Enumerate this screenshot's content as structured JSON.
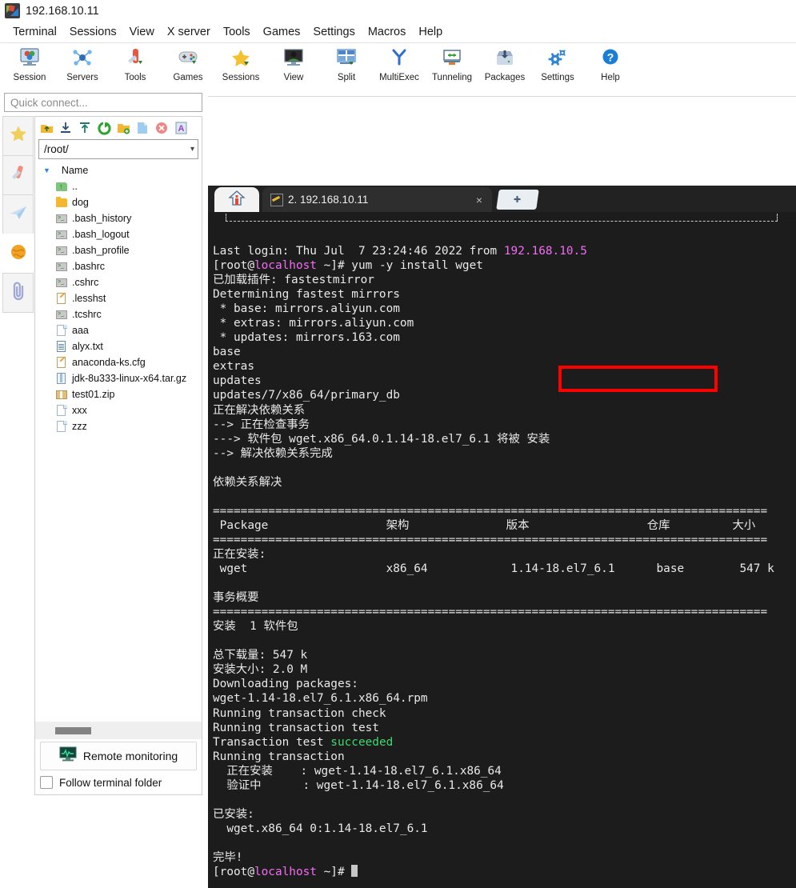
{
  "window": {
    "title": "192.168.10.11",
    "icon": "mobaxterm-logo-icon"
  },
  "menubar": {
    "items": [
      {
        "label": "Terminal"
      },
      {
        "label": "Sessions"
      },
      {
        "label": "View"
      },
      {
        "label": "X server"
      },
      {
        "label": "Tools"
      },
      {
        "label": "Games"
      },
      {
        "label": "Settings"
      },
      {
        "label": "Macros"
      },
      {
        "label": "Help"
      }
    ]
  },
  "toolbar": {
    "buttons": [
      {
        "label": "Session",
        "icon": "session-icon"
      },
      {
        "label": "Servers",
        "icon": "servers-icon"
      },
      {
        "label": "Tools",
        "icon": "tools-icon"
      },
      {
        "label": "Games",
        "icon": "gamepad-icon"
      },
      {
        "label": "Sessions",
        "icon": "star-icon"
      },
      {
        "label": "View",
        "icon": "monitor-icon"
      },
      {
        "label": "Split",
        "icon": "split-icon"
      },
      {
        "label": "MultiExec",
        "icon": "multiexec-icon"
      },
      {
        "label": "Tunneling",
        "icon": "tunneling-icon"
      },
      {
        "label": "Packages",
        "icon": "packages-icon"
      },
      {
        "label": "Settings",
        "icon": "gear-icon"
      },
      {
        "label": "Help",
        "icon": "help-icon"
      }
    ]
  },
  "quick_connect": {
    "placeholder": "Quick connect..."
  },
  "side_tabs": [
    {
      "name": "sessions-star",
      "icon": "star-icon"
    },
    {
      "name": "tools-knife",
      "icon": "swiss-knife-icon"
    },
    {
      "name": "macros-plane",
      "icon": "paper-plane-icon"
    },
    {
      "name": "globe",
      "icon": "globe-icon"
    },
    {
      "name": "attachments",
      "icon": "paperclip-icon"
    }
  ],
  "file_browser": {
    "tool_icons": [
      {
        "name": "go-up-icon"
      },
      {
        "name": "download-icon"
      },
      {
        "name": "upload-icon"
      },
      {
        "name": "refresh-icon"
      },
      {
        "name": "new-folder-icon"
      },
      {
        "name": "new-file-icon"
      },
      {
        "name": "delete-icon"
      },
      {
        "name": "text-mode-icon"
      }
    ],
    "path": "/root/",
    "column_header": "Name",
    "files": [
      {
        "name": "..",
        "type": "up"
      },
      {
        "name": "dog",
        "type": "folder"
      },
      {
        "name": ".bash_history",
        "type": "sh"
      },
      {
        "name": ".bash_logout",
        "type": "sh"
      },
      {
        "name": ".bash_profile",
        "type": "sh"
      },
      {
        "name": ".bashrc",
        "type": "sh"
      },
      {
        "name": ".cshrc",
        "type": "sh"
      },
      {
        "name": ".lesshst",
        "type": "cfg"
      },
      {
        "name": ".tcshrc",
        "type": "sh"
      },
      {
        "name": "aaa",
        "type": "doc"
      },
      {
        "name": "alyx.txt",
        "type": "txt"
      },
      {
        "name": "anaconda-ks.cfg",
        "type": "cfg"
      },
      {
        "name": "jdk-8u333-linux-x64.tar.gz",
        "type": "arch"
      },
      {
        "name": "test01.zip",
        "type": "zipf"
      },
      {
        "name": "xxx",
        "type": "doc"
      },
      {
        "name": "zzz",
        "type": "doc"
      }
    ],
    "remote_monitoring_label": "Remote monitoring",
    "follow_terminal_folder_label": "Follow terminal folder",
    "follow_terminal_folder_checked": false
  },
  "tabs": {
    "home_icon": "home-icon",
    "active_tab_label": "2. 192.168.10.11",
    "close_glyph": "×",
    "new_tab_glyph": "✚"
  },
  "terminal": {
    "highlight_color": "#ff0000",
    "highlighted_command": "yum -y install wget",
    "lines": [
      [
        {
          "t": "Last login: Thu Jul  7 23:24:46 2022 from ",
          "c": "white"
        },
        {
          "t": "192.168.10.5",
          "c": "magenta"
        }
      ],
      [
        {
          "t": "[root@",
          "c": "white"
        },
        {
          "t": "localhost",
          "c": "magenta"
        },
        {
          "t": " ~]# ",
          "c": "white"
        },
        {
          "t": "yum -y install wget",
          "c": "white"
        }
      ],
      [
        {
          "t": "已加载插件: fastestmirror",
          "c": "white"
        }
      ],
      [
        {
          "t": "Determining fastest mirrors",
          "c": "white"
        }
      ],
      [
        {
          "t": " * base: mirrors.aliyun.com",
          "c": "white"
        }
      ],
      [
        {
          "t": " * extras: mirrors.aliyun.com",
          "c": "white"
        }
      ],
      [
        {
          "t": " * updates: mirrors.163.com",
          "c": "white"
        }
      ],
      [
        {
          "t": "base",
          "c": "white"
        }
      ],
      [
        {
          "t": "extras",
          "c": "white"
        }
      ],
      [
        {
          "t": "updates",
          "c": "white"
        }
      ],
      [
        {
          "t": "updates/7/x86_64/primary_db",
          "c": "white"
        }
      ],
      [
        {
          "t": "正在解决依赖关系",
          "c": "white"
        }
      ],
      [
        {
          "t": "--> 正在检查事务",
          "c": "white"
        }
      ],
      [
        {
          "t": "---> 软件包 wget.x86_64.0.1.14-18.el7_6.1 将被 安装",
          "c": "white"
        }
      ],
      [
        {
          "t": "--> 解决依赖关系完成",
          "c": "white"
        }
      ],
      [
        {
          "t": "",
          "c": "white"
        }
      ],
      [
        {
          "t": "依赖关系解决",
          "c": "white"
        }
      ],
      [
        {
          "t": "",
          "c": "white"
        }
      ],
      [
        {
          "t": "================================================================================",
          "c": "white"
        }
      ],
      [
        {
          "t": " Package                 架构              版本                 仓库         大小",
          "c": "white"
        }
      ],
      [
        {
          "t": "================================================================================",
          "c": "white"
        }
      ],
      [
        {
          "t": "正在安装:",
          "c": "white"
        }
      ],
      [
        {
          "t": " wget                    x86_64            1.14-18.el7_6.1      base        547 k",
          "c": "white"
        }
      ],
      [
        {
          "t": "",
          "c": "white"
        }
      ],
      [
        {
          "t": "事务概要",
          "c": "white"
        }
      ],
      [
        {
          "t": "================================================================================",
          "c": "white"
        }
      ],
      [
        {
          "t": "安装  1 软件包",
          "c": "white"
        }
      ],
      [
        {
          "t": "",
          "c": "white"
        }
      ],
      [
        {
          "t": "总下载量: 547 k",
          "c": "white"
        }
      ],
      [
        {
          "t": "安装大小: 2.0 M",
          "c": "white"
        }
      ],
      [
        {
          "t": "Downloading packages:",
          "c": "white"
        }
      ],
      [
        {
          "t": "wget-1.14-18.el7_6.1.x86_64.rpm",
          "c": "white"
        }
      ],
      [
        {
          "t": "Running transaction check",
          "c": "white"
        }
      ],
      [
        {
          "t": "Running transaction test",
          "c": "white"
        }
      ],
      [
        {
          "t": "Transaction test ",
          "c": "white"
        },
        {
          "t": "succeeded",
          "c": "green"
        }
      ],
      [
        {
          "t": "Running transaction",
          "c": "white"
        }
      ],
      [
        {
          "t": "  正在安装    : wget-1.14-18.el7_6.1.x86_64",
          "c": "white"
        }
      ],
      [
        {
          "t": "  验证中      : wget-1.14-18.el7_6.1.x86_64",
          "c": "white"
        }
      ],
      [
        {
          "t": "",
          "c": "white"
        }
      ],
      [
        {
          "t": "已安装:",
          "c": "white"
        }
      ],
      [
        {
          "t": "  wget.x86_64 0:1.14-18.el7_6.1",
          "c": "white"
        }
      ],
      [
        {
          "t": "",
          "c": "white"
        }
      ],
      [
        {
          "t": "完毕!",
          "c": "white"
        }
      ],
      [
        {
          "t": "[root@",
          "c": "white"
        },
        {
          "t": "localhost",
          "c": "magenta"
        },
        {
          "t": " ~]# ",
          "c": "white"
        },
        {
          "t": "__CURSOR__",
          "c": "white"
        }
      ]
    ]
  }
}
